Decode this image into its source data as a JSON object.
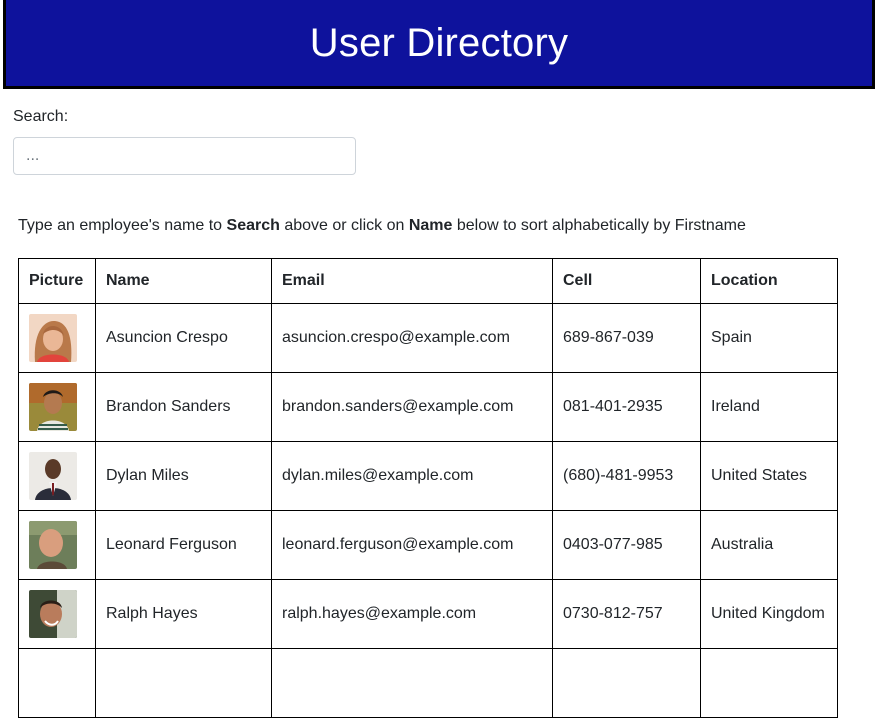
{
  "header": {
    "title": "User Directory",
    "bg_color": "#0e129c"
  },
  "search": {
    "label": "Search:",
    "placeholder": "...",
    "value": ""
  },
  "instructions": {
    "part1": "Type an employee's name to ",
    "bold1": "Search",
    "part2": " above or click on ",
    "bold2": "Name",
    "part3": " below to sort alphabetically by Firstname"
  },
  "table": {
    "columns": [
      "Picture",
      "Name",
      "Email",
      "Cell",
      "Location"
    ],
    "rows": [
      {
        "name": "Asuncion Crespo",
        "email": "asuncion.crespo@example.com",
        "cell": "689-867-039",
        "location": "Spain"
      },
      {
        "name": "Brandon Sanders",
        "email": "brandon.sanders@example.com",
        "cell": "081-401-2935",
        "location": "Ireland"
      },
      {
        "name": "Dylan Miles",
        "email": "dylan.miles@example.com",
        "cell": "(680)-481-9953",
        "location": "United States"
      },
      {
        "name": "Leonard Ferguson",
        "email": "leonard.ferguson@example.com",
        "cell": "0403-077-985",
        "location": "Australia"
      },
      {
        "name": "Ralph Hayes",
        "email": "ralph.hayes@example.com",
        "cell": "0730-812-757",
        "location": "United Kingdom"
      },
      {
        "name": "",
        "email": "",
        "cell": "",
        "location": ""
      }
    ]
  }
}
